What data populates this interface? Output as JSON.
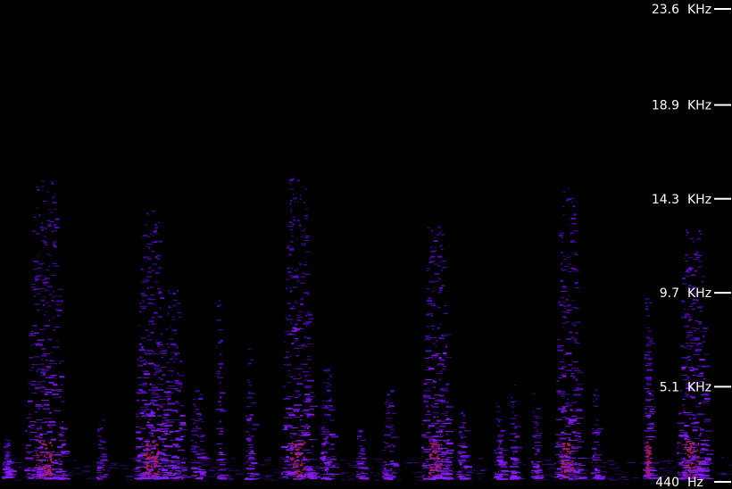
{
  "chart_data": {
    "type": "heatmap",
    "title": "",
    "xlabel": "",
    "ylabel": "",
    "y_axis": {
      "ticks": [
        {
          "value": 23.6,
          "label": "23.6",
          "unit": "KHz"
        },
        {
          "value": 18.9,
          "label": "18.9",
          "unit": "KHz"
        },
        {
          "value": 14.3,
          "label": "14.3",
          "unit": "KHz"
        },
        {
          "value": 9.7,
          "label": "9.7",
          "unit": "KHz"
        },
        {
          "value": 5.1,
          "label": "5.1",
          "unit": "KHz"
        },
        {
          "value": 0.44,
          "label": "440",
          "unit": "Hz"
        }
      ],
      "range_khz": [
        0.44,
        23.6
      ]
    },
    "colors": {
      "background": "#000000",
      "low": "#5a0fc8",
      "mid": "#8a1cff",
      "high": "#b0205a",
      "axis": "#ffffff"
    },
    "bursts": [
      {
        "pos": 0.008,
        "width": 0.012,
        "top_khz": 2.6,
        "intensity": 0.35
      },
      {
        "pos": 0.06,
        "width": 0.055,
        "top_khz": 15.2,
        "intensity": 0.9
      },
      {
        "pos": 0.136,
        "width": 0.01,
        "top_khz": 3.5,
        "intensity": 0.3
      },
      {
        "pos": 0.205,
        "width": 0.045,
        "top_khz": 13.8,
        "intensity": 1.0
      },
      {
        "pos": 0.235,
        "width": 0.03,
        "top_khz": 10.0,
        "intensity": 0.6
      },
      {
        "pos": 0.268,
        "width": 0.02,
        "top_khz": 5.0,
        "intensity": 0.35
      },
      {
        "pos": 0.298,
        "width": 0.008,
        "top_khz": 9.4,
        "intensity": 0.4
      },
      {
        "pos": 0.34,
        "width": 0.012,
        "top_khz": 7.0,
        "intensity": 0.4
      },
      {
        "pos": 0.405,
        "width": 0.045,
        "top_khz": 15.6,
        "intensity": 0.9
      },
      {
        "pos": 0.445,
        "width": 0.02,
        "top_khz": 6.0,
        "intensity": 0.5
      },
      {
        "pos": 0.49,
        "width": 0.01,
        "top_khz": 3.0,
        "intensity": 0.3
      },
      {
        "pos": 0.53,
        "width": 0.018,
        "top_khz": 5.0,
        "intensity": 0.35
      },
      {
        "pos": 0.594,
        "width": 0.04,
        "top_khz": 13.0,
        "intensity": 0.95
      },
      {
        "pos": 0.63,
        "width": 0.015,
        "top_khz": 4.0,
        "intensity": 0.35
      },
      {
        "pos": 0.68,
        "width": 0.012,
        "top_khz": 4.3,
        "intensity": 0.4
      },
      {
        "pos": 0.7,
        "width": 0.01,
        "top_khz": 5.5,
        "intensity": 0.45
      },
      {
        "pos": 0.73,
        "width": 0.01,
        "top_khz": 4.8,
        "intensity": 0.4
      },
      {
        "pos": 0.774,
        "width": 0.035,
        "top_khz": 15.0,
        "intensity": 0.85
      },
      {
        "pos": 0.812,
        "width": 0.01,
        "top_khz": 5.5,
        "intensity": 0.35
      },
      {
        "pos": 0.884,
        "width": 0.012,
        "top_khz": 9.5,
        "intensity": 0.7
      },
      {
        "pos": 0.945,
        "width": 0.045,
        "top_khz": 12.8,
        "intensity": 0.9
      }
    ]
  }
}
